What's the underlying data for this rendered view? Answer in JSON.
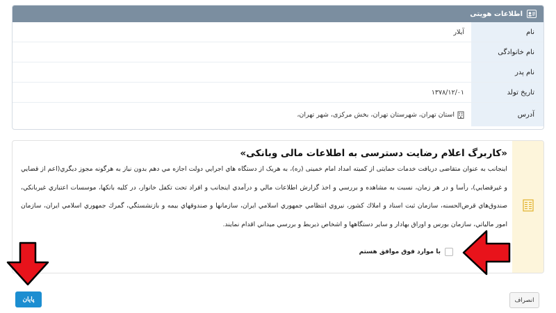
{
  "identity": {
    "header_title": "اطلاعات هويتی",
    "header_icon": "id-card-icon",
    "rows": [
      {
        "label": "نام",
        "value": "آيلار"
      },
      {
        "label": "نام خانوادگی",
        "value": ""
      },
      {
        "label": "نام پدر",
        "value": ""
      },
      {
        "label": "تاريخ تولد",
        "value": "۱۳۷۸/۱۲/۰۱"
      },
      {
        "label": "آدرس",
        "value": "استان تهران، شهرستان تهران، بخش مرکزی، شهر تهران،"
      }
    ],
    "address_icon": "building-icon"
  },
  "consent": {
    "title": "«کاربرگ اعلام رضايت دسترسی به اطلاعات مالی وبانکی»",
    "text": "اينجانب به عنوان متقاضی دريافت خدمات حمايتی از کميته امداد امام خمينی (ره)، به هريک از دستگاه هاي اجرايي دولت اجازه مي دهم بدون نياز به هرگونه مجوز ديگري(اعم از قضايي و غيرقضايي)، رأسا و در هر زمان، نسبت به مشاهده و بررسي و اخذ گزارش اطلاعات مالي و درآمدي اينجانب و افراد تحت تكفل خانوار، در كليه بانكها، موسسات اعتباري غيربانكي، صندوق‌هاي قرض‌الحسنه، سازمان ثبت اسناد و املاك كشور، نيروي انتظامي جمهوري اسلامي ايران، سازمانها و صندوقهاي بيمه و بازنشستگي، گمرك جمهوري اسلامي ايران، سازمان امور مالياتي، سازمان بورس و اوراق بهادار و ساير دستگاهها و اشخاص ذيربط و بررسي ميداني اقدام نمايند.",
    "agree_label": "با موارد فوق موافق هستم",
    "side_icon": "form-icon"
  },
  "buttons": {
    "ok_label": "پايان",
    "cancel_label": "انصراف"
  },
  "annotations": {
    "arrow_color": "#e8131b"
  }
}
